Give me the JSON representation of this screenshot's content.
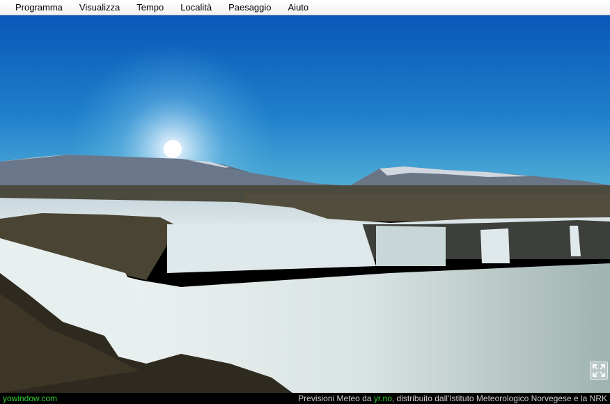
{
  "menu": {
    "items": [
      "Programma",
      "Visualizza",
      "Tempo",
      "Località",
      "Paesaggio",
      "Aiuto"
    ]
  },
  "footer": {
    "brand": "yowindow.com",
    "credit_prefix": "Previsioni Meteo da ",
    "credit_link": "yr.no",
    "credit_suffix": ", distribuito dall'Istituto Meteorologico Norvegese e la NRK"
  },
  "scene": {
    "description_icon": "fullscreen-icon",
    "colors": {
      "sky_top": "#0a5fbf",
      "sky_horizon": "#3ea6d4",
      "link": "#33cc33"
    }
  }
}
